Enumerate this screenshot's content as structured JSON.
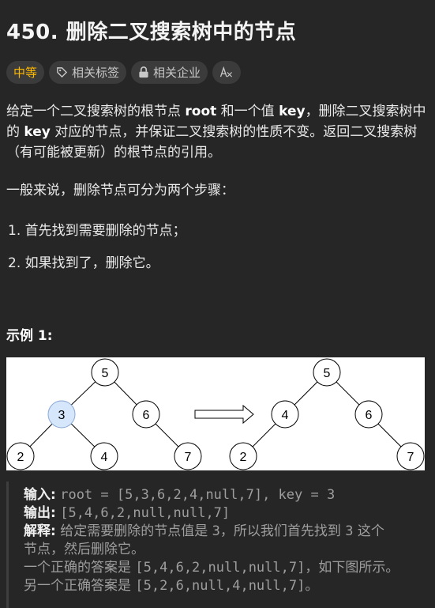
{
  "problem": {
    "title": "450. 删除二叉搜索树中的节点"
  },
  "tags": [
    {
      "label": "中等",
      "icon": null,
      "color": "#ffb800"
    },
    {
      "label": "相关标签",
      "icon": "tag-icon"
    },
    {
      "label": "相关企业",
      "icon": "lock-icon"
    },
    {
      "label": "",
      "icon": "translate-icon"
    }
  ],
  "description": {
    "p1": [
      "给定一个二叉搜索树的根节点 ",
      "root",
      " 和一个值 ",
      "key",
      "，删除二叉搜索树中的 ",
      "key",
      " 对应的节点，并保证二叉搜索树的性质不变。返回二叉搜索树（有可能被更新）的根节点的引用。"
    ],
    "p2": "一般来说，删除节点可分为两个步骤：",
    "steps": [
      "首先找到需要删除的节点；",
      "如果找到了，删除它。"
    ]
  },
  "example": {
    "title": "示例 1:",
    "before_tree": [
      {
        "id": "n5",
        "value": "5",
        "highlight": false
      },
      {
        "id": "n3",
        "value": "3",
        "highlight": true
      },
      {
        "id": "n6",
        "value": "6",
        "highlight": false
      },
      {
        "id": "n2",
        "value": "2",
        "highlight": false
      },
      {
        "id": "n4",
        "value": "4",
        "highlight": false
      },
      {
        "id": "n7",
        "value": "7",
        "highlight": false
      }
    ],
    "after_tree": [
      {
        "id": "m5",
        "value": "5"
      },
      {
        "id": "m4",
        "value": "4"
      },
      {
        "id": "m6",
        "value": "6"
      },
      {
        "id": "m2",
        "value": "2"
      },
      {
        "id": "m7",
        "value": "7"
      }
    ],
    "input_label": "输入:",
    "input_value": "root = [5,3,6,2,4,null,7], key = 3",
    "output_label": "输出:",
    "output_value": "[5,4,6,2,null,null,7]",
    "explain_label": "解释:",
    "explain_line1_pre": "给定需要删除的节点值是 ",
    "explain_line1_code1": "3",
    "explain_line1_mid": "，所以我们首先找到 ",
    "explain_line1_code2": "3",
    "explain_line1_post": " 这个",
    "explain_line2": "节点，然后删除它。",
    "explain_line3_pre": "一个正确的答案是 ",
    "explain_line3_code": "[5,4,6,2,null,null,7]",
    "explain_line3_post": "，如下图所示。",
    "explain_line4_pre": "另一个正确答案是 ",
    "explain_line4_code": "[5,2,6,null,4,null,7]",
    "explain_line4_post": "。"
  },
  "colors": {
    "background": "#262626",
    "difficulty": "#ffb800",
    "highlight_node": "#d6e6fb"
  }
}
